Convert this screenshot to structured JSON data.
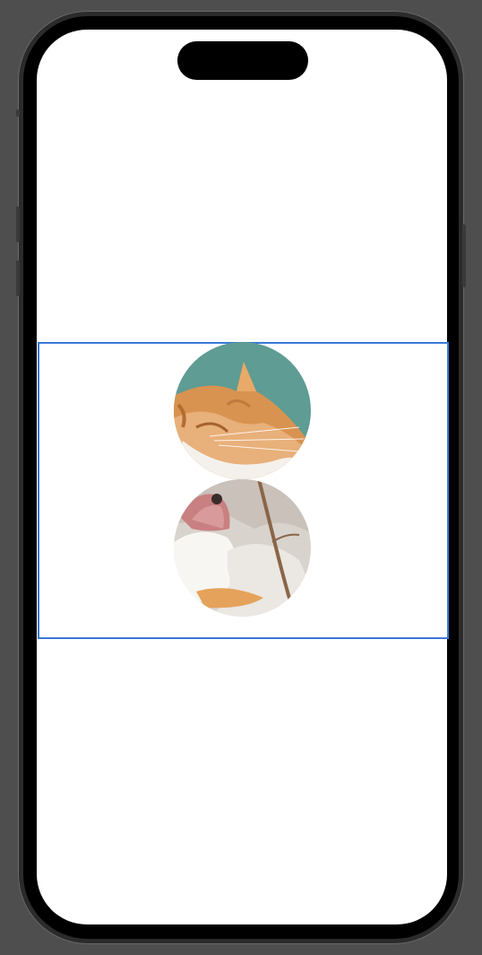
{
  "device": {
    "model_label": "",
    "screen_background": "#ffffff",
    "frame_color": "#2b2b2b",
    "highlight_color": "#3a78d8"
  },
  "content": {
    "images": [
      {
        "name": "cat-ear-photo",
        "alt": ""
      },
      {
        "name": "cat-licking-photo",
        "alt": ""
      }
    ]
  }
}
